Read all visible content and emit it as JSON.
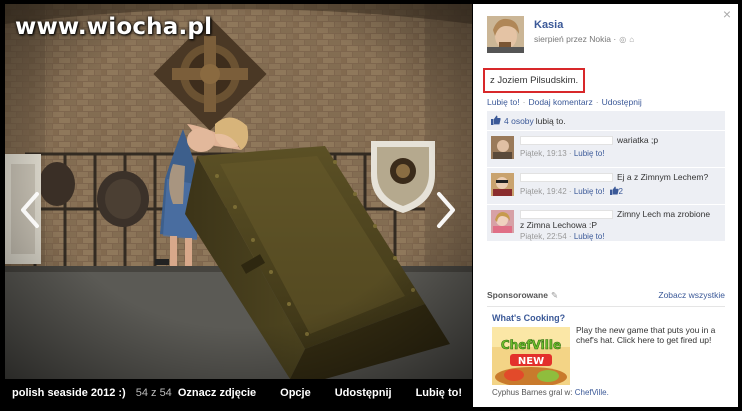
{
  "watermark": "www.wiocha.pl",
  "photo_bar": {
    "album": "polish seaside 2012 :)",
    "counter": "54 z 54",
    "actions": [
      "Oznacz zdjęcie",
      "Opcje",
      "Udostępnij",
      "Lubię to!"
    ]
  },
  "panel": {
    "close": "×",
    "author": "Kasia",
    "meta": "sierpień przez Nokia ·",
    "post_text": "z Joziem Pilsudskim.",
    "actions": [
      "Lubię to!",
      "Dodaj komentarz",
      "Udostępnij"
    ],
    "likes_count": "4 osoby",
    "likes_suffix": "lubią to.",
    "comments": [
      {
        "text": "wariatka ;p",
        "text2": "",
        "time": "Piątek, 19:13",
        "like": "Lubię to!",
        "likes": ""
      },
      {
        "text": "Ej a z Zimnym Lechem?",
        "text2": "",
        "time": "Piątek, 19:42",
        "like": "Lubię to!",
        "likes": "2"
      },
      {
        "text": "Zimny Lech ma zrobione",
        "text2": "z Zimna Lechowa :P",
        "time": "Piątek, 22:54",
        "like": "Lubię to!",
        "likes": ""
      }
    ],
    "sponsored_label": "Sponsorowane",
    "sponsored_all": "Zobacz wszystkie",
    "ad_title": "What's Cooking?",
    "ad_text": "Play the new game that puts you in a chef's hat. Click here to get fired up!",
    "ad_logo": "ChefVille",
    "ad_badge": "NEW",
    "ad_social_name": "Cyphus Barnes gral w:",
    "ad_social_link": "ChefVille."
  },
  "colors": {
    "fb_blue": "#3b5998",
    "highlight": "#d8282a",
    "ufi_bg": "#edeff4"
  }
}
